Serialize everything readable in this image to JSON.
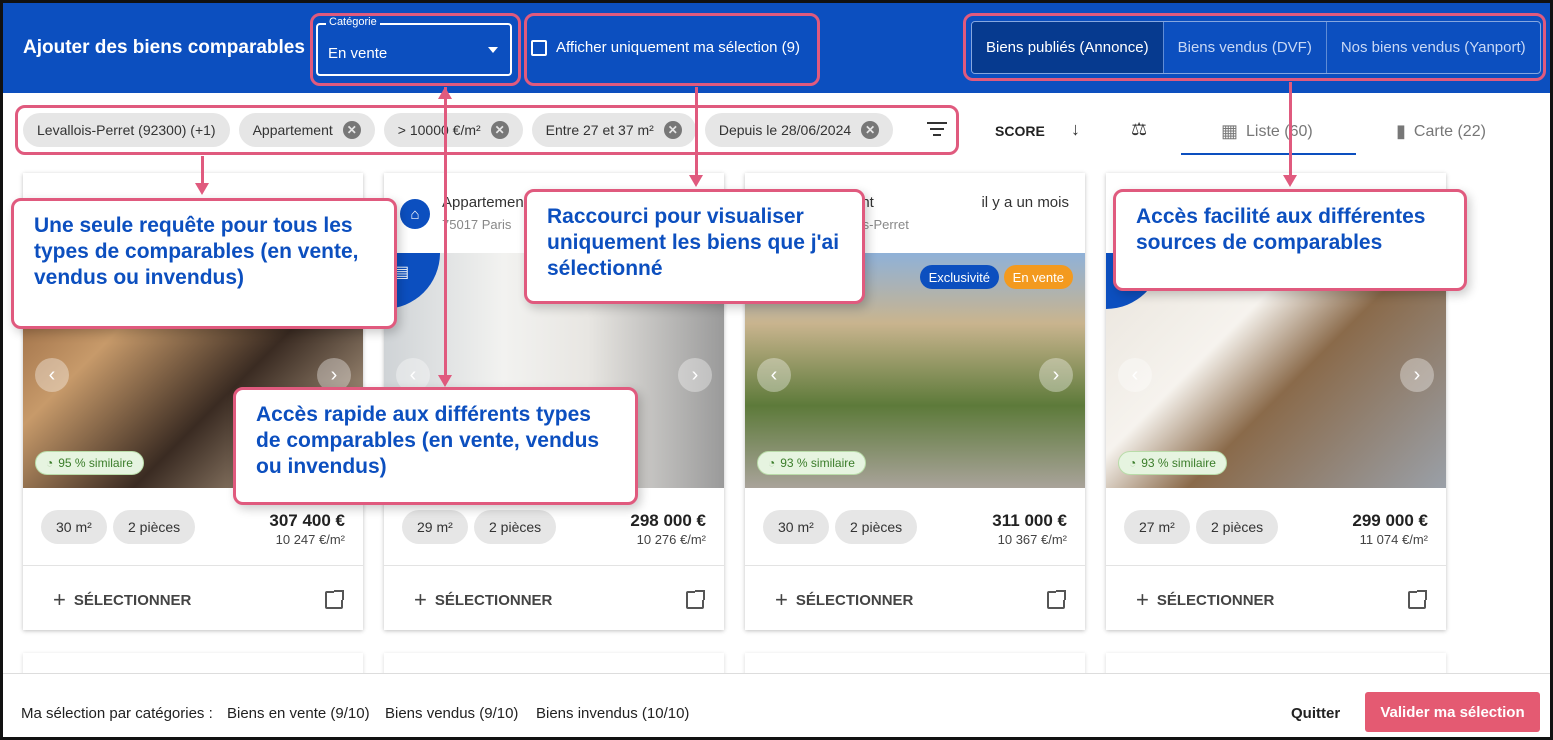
{
  "header": {
    "title": "Ajouter des biens comparables",
    "category_label": "Catégorie",
    "category_value": "En vente",
    "checkbox_label": "Afficher uniquement ma sélection (9)",
    "sources": [
      "Biens publiés (Annonce)",
      "Biens vendus (DVF)",
      "Nos biens vendus (Yanport)"
    ]
  },
  "filters": {
    "chips": [
      "Levallois-Perret (92300) (+1)",
      "Appartement",
      "> 10000 €/m²",
      "Entre 27 et 37 m²",
      "Depuis le 28/06/2024"
    ],
    "sort_label": "SCORE",
    "tab_list": "Liste (60)",
    "tab_map": "Carte (22)"
  },
  "cards": [
    {
      "type": "",
      "address": "",
      "date": "",
      "similarity": "95 % similaire",
      "area": "30 m²",
      "rooms": "2 pièces",
      "price": "307 400 €",
      "price_m2": "10 247 €/m²",
      "select": "SÉLECTIONNER"
    },
    {
      "type": "Appartemen",
      "address": "75017 Paris",
      "date": "",
      "similarity": "",
      "area": "29 m²",
      "rooms": "2 pièces",
      "price": "298 000 €",
      "price_m2": "10 276 €/m²",
      "select": "SÉLECTIONNER"
    },
    {
      "type": "rtement",
      "address": "vallois-Perret",
      "date": "il y a un mois",
      "similarity": "93 % similaire",
      "badge_exclusive": "Exclusivité",
      "badge_sale": "En vente",
      "area": "30 m²",
      "rooms": "2 pièces",
      "price": "311 000 €",
      "price_m2": "10 367 €/m²",
      "select": "SÉLECTIONNER"
    },
    {
      "type": "",
      "address": "",
      "date": "",
      "similarity": "93 % similaire",
      "area": "27 m²",
      "rooms": "2 pièces",
      "price": "299 000 €",
      "price_m2": "11 074 €/m²",
      "select": "SÉLECTIONNER"
    }
  ],
  "footer": {
    "label": "Ma sélection par catégories :",
    "items": [
      "Biens en vente (9/10)",
      "Biens vendus (9/10)",
      "Biens invendus (10/10)"
    ],
    "quit": "Quitter",
    "validate": "Valider ma sélection"
  },
  "callouts": {
    "one_query": "Une seule requête pour tous les types de comparables (en vente, vendus ou invendus)",
    "shortcut": "Raccourci pour visualiser uniquement les biens que j'ai sélectionné",
    "sources_access": "Accès facilité aux différentes sources de comparables",
    "quick_access": "Accès rapide aux différents types de comparables (en vente, vendus ou invendus)"
  },
  "colors": {
    "primary": "#0c4fbf",
    "accent": "#e05a7e",
    "validate": "#e45a72",
    "sale_badge": "#f39a1f"
  }
}
